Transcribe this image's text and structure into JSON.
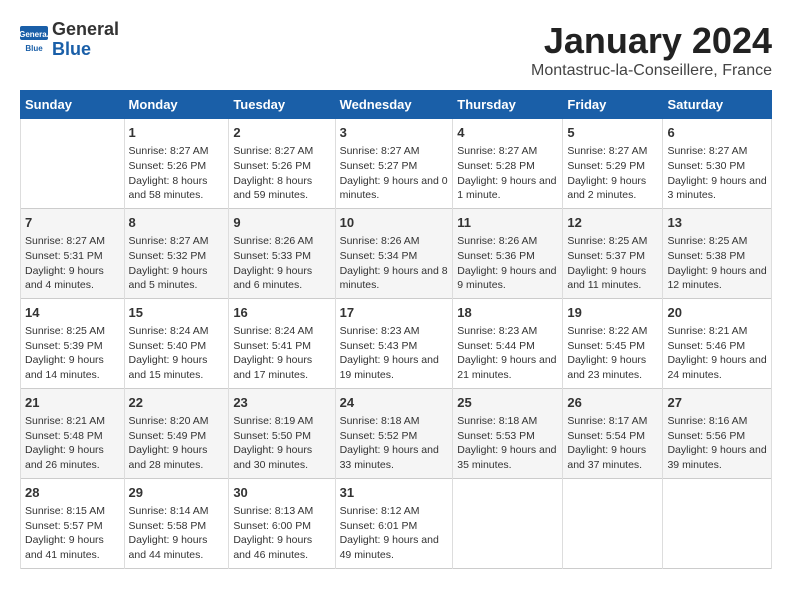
{
  "header": {
    "logo_general": "General",
    "logo_blue": "Blue",
    "month": "January 2024",
    "location": "Montastruc-la-Conseillere, France"
  },
  "days_of_week": [
    "Sunday",
    "Monday",
    "Tuesday",
    "Wednesday",
    "Thursday",
    "Friday",
    "Saturday"
  ],
  "weeks": [
    [
      {
        "day": "",
        "sunrise": "",
        "sunset": "",
        "daylight": ""
      },
      {
        "day": "1",
        "sunrise": "Sunrise: 8:27 AM",
        "sunset": "Sunset: 5:26 PM",
        "daylight": "Daylight: 8 hours and 58 minutes."
      },
      {
        "day": "2",
        "sunrise": "Sunrise: 8:27 AM",
        "sunset": "Sunset: 5:26 PM",
        "daylight": "Daylight: 8 hours and 59 minutes."
      },
      {
        "day": "3",
        "sunrise": "Sunrise: 8:27 AM",
        "sunset": "Sunset: 5:27 PM",
        "daylight": "Daylight: 9 hours and 0 minutes."
      },
      {
        "day": "4",
        "sunrise": "Sunrise: 8:27 AM",
        "sunset": "Sunset: 5:28 PM",
        "daylight": "Daylight: 9 hours and 1 minute."
      },
      {
        "day": "5",
        "sunrise": "Sunrise: 8:27 AM",
        "sunset": "Sunset: 5:29 PM",
        "daylight": "Daylight: 9 hours and 2 minutes."
      },
      {
        "day": "6",
        "sunrise": "Sunrise: 8:27 AM",
        "sunset": "Sunset: 5:30 PM",
        "daylight": "Daylight: 9 hours and 3 minutes."
      }
    ],
    [
      {
        "day": "7",
        "sunrise": "Sunrise: 8:27 AM",
        "sunset": "Sunset: 5:31 PM",
        "daylight": "Daylight: 9 hours and 4 minutes."
      },
      {
        "day": "8",
        "sunrise": "Sunrise: 8:27 AM",
        "sunset": "Sunset: 5:32 PM",
        "daylight": "Daylight: 9 hours and 5 minutes."
      },
      {
        "day": "9",
        "sunrise": "Sunrise: 8:26 AM",
        "sunset": "Sunset: 5:33 PM",
        "daylight": "Daylight: 9 hours and 6 minutes."
      },
      {
        "day": "10",
        "sunrise": "Sunrise: 8:26 AM",
        "sunset": "Sunset: 5:34 PM",
        "daylight": "Daylight: 9 hours and 8 minutes."
      },
      {
        "day": "11",
        "sunrise": "Sunrise: 8:26 AM",
        "sunset": "Sunset: 5:36 PM",
        "daylight": "Daylight: 9 hours and 9 minutes."
      },
      {
        "day": "12",
        "sunrise": "Sunrise: 8:25 AM",
        "sunset": "Sunset: 5:37 PM",
        "daylight": "Daylight: 9 hours and 11 minutes."
      },
      {
        "day": "13",
        "sunrise": "Sunrise: 8:25 AM",
        "sunset": "Sunset: 5:38 PM",
        "daylight": "Daylight: 9 hours and 12 minutes."
      }
    ],
    [
      {
        "day": "14",
        "sunrise": "Sunrise: 8:25 AM",
        "sunset": "Sunset: 5:39 PM",
        "daylight": "Daylight: 9 hours and 14 minutes."
      },
      {
        "day": "15",
        "sunrise": "Sunrise: 8:24 AM",
        "sunset": "Sunset: 5:40 PM",
        "daylight": "Daylight: 9 hours and 15 minutes."
      },
      {
        "day": "16",
        "sunrise": "Sunrise: 8:24 AM",
        "sunset": "Sunset: 5:41 PM",
        "daylight": "Daylight: 9 hours and 17 minutes."
      },
      {
        "day": "17",
        "sunrise": "Sunrise: 8:23 AM",
        "sunset": "Sunset: 5:43 PM",
        "daylight": "Daylight: 9 hours and 19 minutes."
      },
      {
        "day": "18",
        "sunrise": "Sunrise: 8:23 AM",
        "sunset": "Sunset: 5:44 PM",
        "daylight": "Daylight: 9 hours and 21 minutes."
      },
      {
        "day": "19",
        "sunrise": "Sunrise: 8:22 AM",
        "sunset": "Sunset: 5:45 PM",
        "daylight": "Daylight: 9 hours and 23 minutes."
      },
      {
        "day": "20",
        "sunrise": "Sunrise: 8:21 AM",
        "sunset": "Sunset: 5:46 PM",
        "daylight": "Daylight: 9 hours and 24 minutes."
      }
    ],
    [
      {
        "day": "21",
        "sunrise": "Sunrise: 8:21 AM",
        "sunset": "Sunset: 5:48 PM",
        "daylight": "Daylight: 9 hours and 26 minutes."
      },
      {
        "day": "22",
        "sunrise": "Sunrise: 8:20 AM",
        "sunset": "Sunset: 5:49 PM",
        "daylight": "Daylight: 9 hours and 28 minutes."
      },
      {
        "day": "23",
        "sunrise": "Sunrise: 8:19 AM",
        "sunset": "Sunset: 5:50 PM",
        "daylight": "Daylight: 9 hours and 30 minutes."
      },
      {
        "day": "24",
        "sunrise": "Sunrise: 8:18 AM",
        "sunset": "Sunset: 5:52 PM",
        "daylight": "Daylight: 9 hours and 33 minutes."
      },
      {
        "day": "25",
        "sunrise": "Sunrise: 8:18 AM",
        "sunset": "Sunset: 5:53 PM",
        "daylight": "Daylight: 9 hours and 35 minutes."
      },
      {
        "day": "26",
        "sunrise": "Sunrise: 8:17 AM",
        "sunset": "Sunset: 5:54 PM",
        "daylight": "Daylight: 9 hours and 37 minutes."
      },
      {
        "day": "27",
        "sunrise": "Sunrise: 8:16 AM",
        "sunset": "Sunset: 5:56 PM",
        "daylight": "Daylight: 9 hours and 39 minutes."
      }
    ],
    [
      {
        "day": "28",
        "sunrise": "Sunrise: 8:15 AM",
        "sunset": "Sunset: 5:57 PM",
        "daylight": "Daylight: 9 hours and 41 minutes."
      },
      {
        "day": "29",
        "sunrise": "Sunrise: 8:14 AM",
        "sunset": "Sunset: 5:58 PM",
        "daylight": "Daylight: 9 hours and 44 minutes."
      },
      {
        "day": "30",
        "sunrise": "Sunrise: 8:13 AM",
        "sunset": "Sunset: 6:00 PM",
        "daylight": "Daylight: 9 hours and 46 minutes."
      },
      {
        "day": "31",
        "sunrise": "Sunrise: 8:12 AM",
        "sunset": "Sunset: 6:01 PM",
        "daylight": "Daylight: 9 hours and 49 minutes."
      },
      {
        "day": "",
        "sunrise": "",
        "sunset": "",
        "daylight": ""
      },
      {
        "day": "",
        "sunrise": "",
        "sunset": "",
        "daylight": ""
      },
      {
        "day": "",
        "sunrise": "",
        "sunset": "",
        "daylight": ""
      }
    ]
  ]
}
